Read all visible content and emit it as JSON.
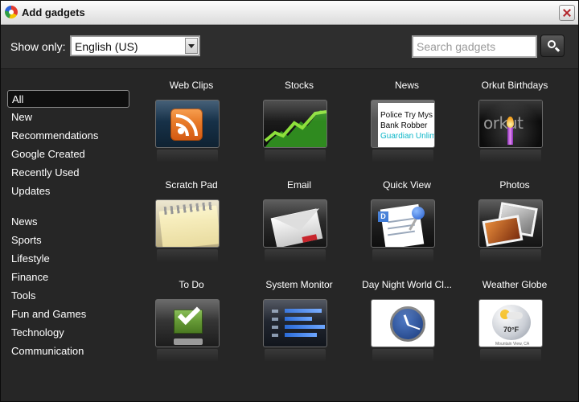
{
  "window": {
    "title": "Add gadgets"
  },
  "toolbar": {
    "show_only_label": "Show only:",
    "language_selected": "English (US)",
    "search_placeholder": "Search gadgets"
  },
  "sidebar": {
    "selected": "All",
    "categories": [
      "All",
      "New",
      "Recommendations",
      "Google Created",
      "Recently Used",
      "Updates",
      "News",
      "Sports",
      "Lifestyle",
      "Finance",
      "Tools",
      "Fun and Games",
      "Technology",
      "Communication"
    ]
  },
  "gadgets": [
    {
      "name": "Web Clips",
      "icon": "rss-icon"
    },
    {
      "name": "Stocks",
      "icon": "stock-chart-icon"
    },
    {
      "name": "News",
      "icon": "newspaper-icon",
      "thumb_lines": [
        "Police Try Mys",
        "Bank Robber",
        "Guardian Unlim"
      ]
    },
    {
      "name": "Orkut Birthdays",
      "icon": "orkut-candle-icon",
      "thumb_word": "orkut"
    },
    {
      "name": "Scratch Pad",
      "icon": "notepad-icon"
    },
    {
      "name": "Email",
      "icon": "envelope-icon"
    },
    {
      "name": "Quick View",
      "icon": "document-pin-icon",
      "badge": "D"
    },
    {
      "name": "Photos",
      "icon": "photos-icon"
    },
    {
      "name": "To Do",
      "icon": "checkbox-icon"
    },
    {
      "name": "System Monitor",
      "icon": "system-bars-icon"
    },
    {
      "name": "Day Night World Cl...",
      "icon": "world-clock-icon"
    },
    {
      "name": "Weather Globe",
      "icon": "weather-globe-icon",
      "temp": "70°F",
      "caption": "Mountain View, CA"
    }
  ],
  "colors": {
    "background": "#262626",
    "toolbar": "#2e2e2e",
    "selected_bg": "#0f0f0f",
    "text": "#ffffff"
  }
}
